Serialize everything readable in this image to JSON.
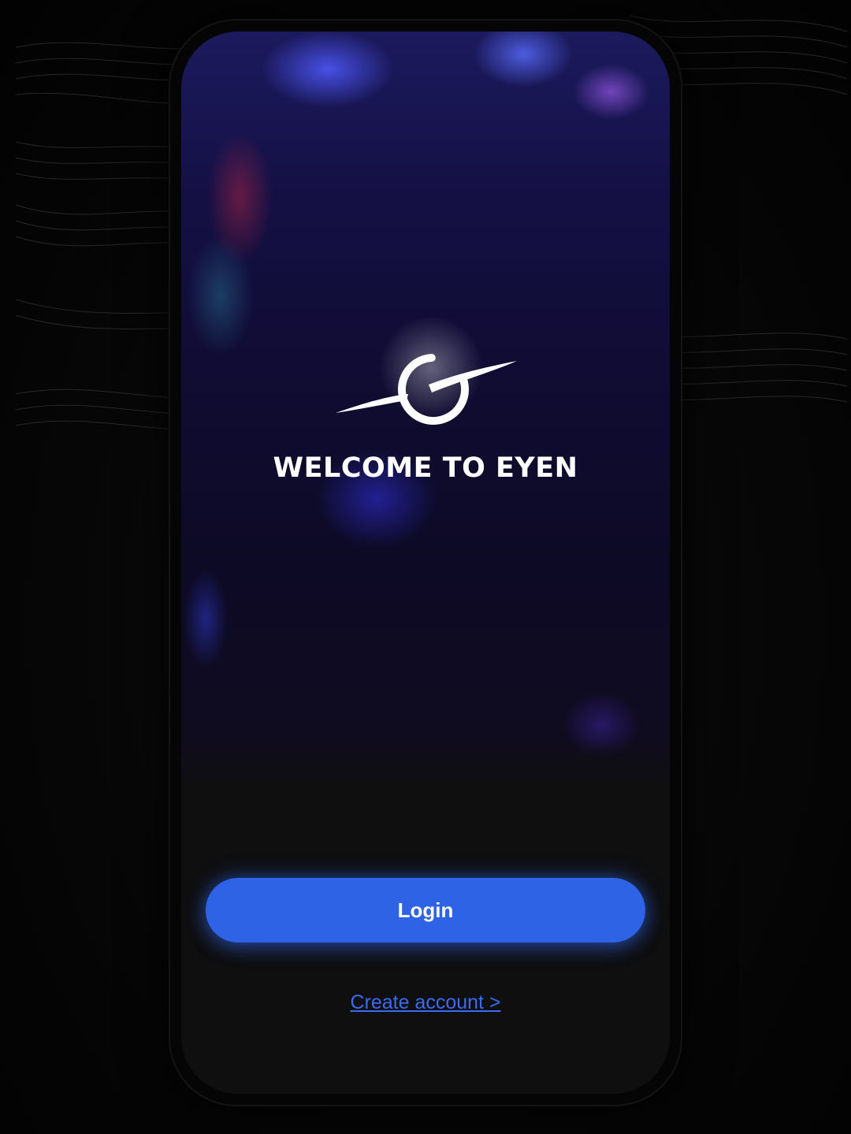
{
  "app": {
    "welcome_title": "WELCOME TO EYEN",
    "logo_icon": "eyen-orbit-logo"
  },
  "actions": {
    "login_label": "Login",
    "create_account_label": "Create account >"
  },
  "colors": {
    "accent": "#2e63e6",
    "link": "#3a6cf0",
    "background": "#050505",
    "screen": "#0f0f10"
  }
}
